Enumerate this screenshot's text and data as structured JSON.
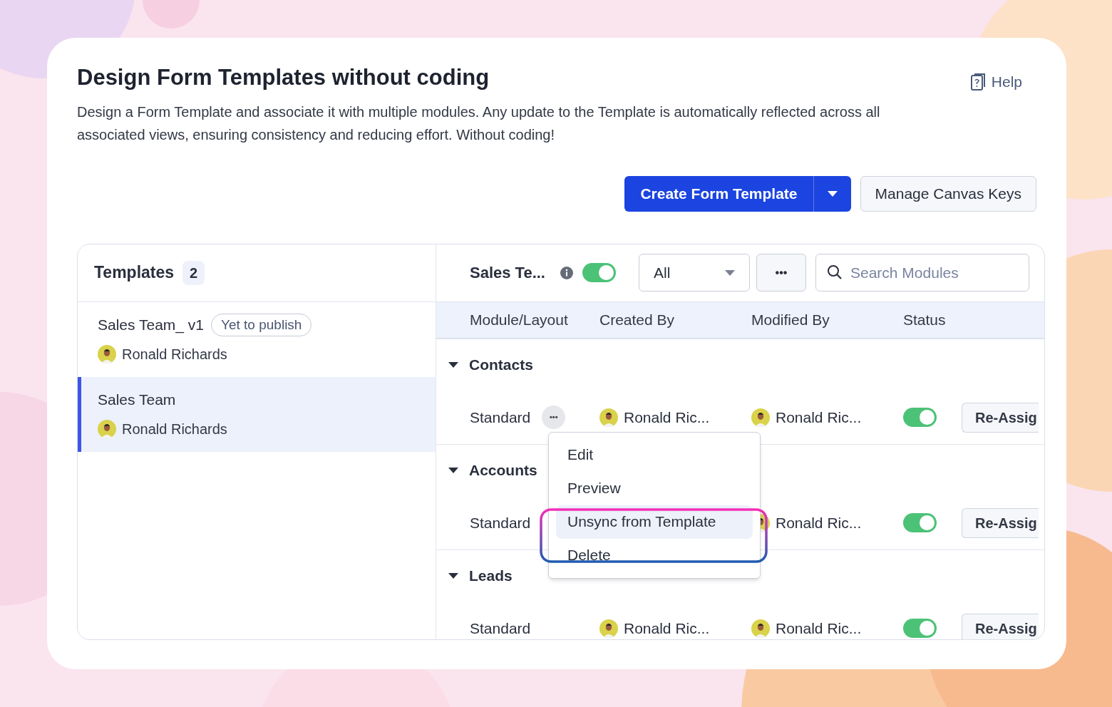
{
  "header": {
    "title": "Design Form Templates without coding",
    "help": "Help",
    "description": "Design a Form Template and associate it with multiple modules. Any update to the Template is automatically reflected across all associated views, ensuring consistency and reducing effort. Without coding!"
  },
  "actions": {
    "primary": "Create Form Template",
    "secondary": "Manage Canvas Keys"
  },
  "templates": {
    "title": "Templates",
    "count": "2",
    "items": [
      {
        "name": "Sales Team_ v1",
        "badge": "Yet to publish",
        "owner": "Ronald Richards",
        "selected": false
      },
      {
        "name": "Sales Team",
        "owner": "Ronald Richards",
        "selected": true
      }
    ]
  },
  "detail": {
    "title": "Sales Te...",
    "on": true,
    "filter": "All",
    "more": "•••",
    "search": {
      "placeholder": "Search Modules"
    },
    "columns": [
      "Module/Layout",
      "Created By",
      "Modified By",
      "Status"
    ],
    "groups": [
      {
        "name": "Contacts",
        "expanded": true,
        "rows": [
          {
            "layout": "Standard",
            "menu_button": "•••",
            "created_by": "Ronald Ric...",
            "modified_by": "Ronald Ric...",
            "on": true,
            "action": "Re-Assig"
          }
        ]
      },
      {
        "name": "Accounts",
        "expanded": true,
        "rows": [
          {
            "layout": "Standard",
            "modified_by": "Ronald Ric...",
            "on": true,
            "action": "Re-Assig"
          }
        ]
      },
      {
        "name": "Leads",
        "expanded": true,
        "rows": [
          {
            "layout": "Standard",
            "created_by": "Ronald Ric...",
            "modified_by": "Ronald Ric...",
            "on": true,
            "action": "Re-Assig"
          }
        ]
      }
    ]
  },
  "context_menu": {
    "items": [
      {
        "label": "Edit",
        "selected": false
      },
      {
        "label": "Preview",
        "selected": false
      },
      {
        "label": "Unsync from Template",
        "selected": true
      },
      {
        "label": "Delete",
        "selected": false
      }
    ]
  }
}
